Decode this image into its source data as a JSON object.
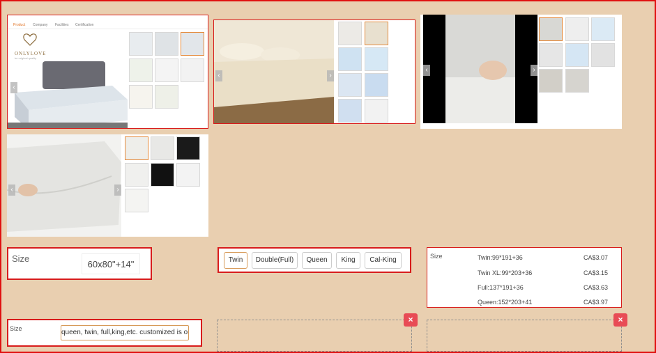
{
  "gallery1": {
    "tabs": [
      "Product",
      "Company",
      "Facilities",
      "Certification"
    ],
    "brand": "ONLYLOVE",
    "brand_tagline": "be original quality"
  },
  "size_single": {
    "label": "Size",
    "value": "60x80\"+14\""
  },
  "size_options": {
    "options": [
      "Twin",
      "Double(Full)",
      "Queen",
      "King",
      "Cal-King"
    ],
    "selected": "Twin"
  },
  "size_table": {
    "label": "Size",
    "rows": [
      {
        "size": "Twin:99*191+36",
        "price": "CA$3.07"
      },
      {
        "size": "Twin XL:99*203+36",
        "price": "CA$3.15"
      },
      {
        "size": "Full:137*191+36",
        "price": "CA$3.63"
      },
      {
        "size": "Queen:152*203+41",
        "price": "CA$3.97"
      }
    ]
  },
  "size_custom": {
    "label": "Size",
    "value": "queen, twin, full,king,etc. customized is ok"
  },
  "empty_slots": {
    "close_symbol": "×"
  },
  "colors": {
    "background": "#e9cfb0",
    "border_red": "#d81c1c",
    "accent_orange": "#e58a3a",
    "close_red": "#e84b55"
  }
}
